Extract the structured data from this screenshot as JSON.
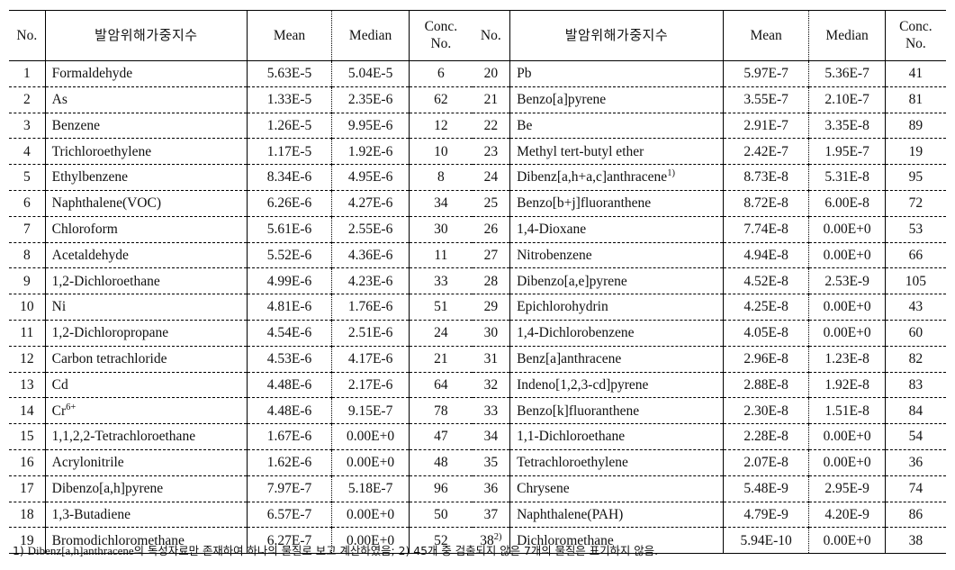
{
  "table_left": {
    "columns": [
      "No.",
      "발암위해가중지수",
      "Mean",
      "Median",
      "Conc. No."
    ],
    "headers": {
      "no": "No.",
      "name": "발암위해가중지수",
      "mean": "Mean",
      "median": "Median",
      "conc_line1": "Conc.",
      "conc_line2": "No."
    },
    "rows": [
      {
        "no": "1",
        "name": "Formaldehyde",
        "mean": "5.63E-5",
        "median": "5.04E-5",
        "conc": "6"
      },
      {
        "no": "2",
        "name": "As",
        "mean": "1.33E-5",
        "median": "2.35E-6",
        "conc": "62"
      },
      {
        "no": "3",
        "name": "Benzene",
        "mean": "1.26E-5",
        "median": "9.95E-6",
        "conc": "12"
      },
      {
        "no": "4",
        "name": "Trichloroethylene",
        "mean": "1.17E-5",
        "median": "1.92E-6",
        "conc": "10"
      },
      {
        "no": "5",
        "name": "Ethylbenzene",
        "mean": "8.34E-6",
        "median": "4.95E-6",
        "conc": "8"
      },
      {
        "no": "6",
        "name": "Naphthalene(VOC)",
        "mean": "6.26E-6",
        "median": "4.27E-6",
        "conc": "34"
      },
      {
        "no": "7",
        "name": "Chloroform",
        "mean": "5.61E-6",
        "median": "2.55E-6",
        "conc": "30"
      },
      {
        "no": "8",
        "name": "Acetaldehyde",
        "mean": "5.52E-6",
        "median": "4.36E-6",
        "conc": "11"
      },
      {
        "no": "9",
        "name": "1,2-Dichloroethane",
        "mean": "4.99E-6",
        "median": "4.23E-6",
        "conc": "33"
      },
      {
        "no": "10",
        "name": "Ni",
        "mean": "4.81E-6",
        "median": "1.76E-6",
        "conc": "51"
      },
      {
        "no": "11",
        "name": "1,2-Dichloropropane",
        "mean": "4.54E-6",
        "median": "2.51E-6",
        "conc": "24"
      },
      {
        "no": "12",
        "name": "Carbon tetrachloride",
        "mean": "4.53E-6",
        "median": "4.17E-6",
        "conc": "21"
      },
      {
        "no": "13",
        "name": "Cd",
        "mean": "4.48E-6",
        "median": "2.17E-6",
        "conc": "64"
      },
      {
        "no": "14",
        "name": "Cr",
        "name_sup": "6+",
        "mean": "4.48E-6",
        "median": "9.15E-7",
        "conc": "78"
      },
      {
        "no": "15",
        "name": "1,1,2,2-Tetrachloroethane",
        "mean": "1.67E-6",
        "median": "0.00E+0",
        "conc": "47"
      },
      {
        "no": "16",
        "name": "Acrylonitrile",
        "mean": "1.62E-6",
        "median": "0.00E+0",
        "conc": "48"
      },
      {
        "no": "17",
        "name": "Dibenzo[a,h]pyrene",
        "mean": "7.97E-7",
        "median": "5.18E-7",
        "conc": "96"
      },
      {
        "no": "18",
        "name": "1,3-Butadiene",
        "mean": "6.57E-7",
        "median": "0.00E+0",
        "conc": "50"
      },
      {
        "no": "19",
        "name": "Bromodichloromethane",
        "mean": "6.27E-7",
        "median": "0.00E+0",
        "conc": "52"
      }
    ]
  },
  "table_right": {
    "columns": [
      "No.",
      "발암위해가중지수",
      "Mean",
      "Median",
      "Conc. No."
    ],
    "headers": {
      "no": "No.",
      "name": "발암위해가중지수",
      "mean": "Mean",
      "median": "Median",
      "conc_line1": "Conc.",
      "conc_line2": "No."
    },
    "rows": [
      {
        "no": "20",
        "name": "Pb",
        "mean": "5.97E-7",
        "median": "5.36E-7",
        "conc": "41"
      },
      {
        "no": "21",
        "name": "Benzo[a]pyrene",
        "mean": "3.55E-7",
        "median": "2.10E-7",
        "conc": "81"
      },
      {
        "no": "22",
        "name": "Be",
        "mean": "2.91E-7",
        "median": "3.35E-8",
        "conc": "89"
      },
      {
        "no": "23",
        "name": "Methyl tert-butyl ether",
        "mean": "2.42E-7",
        "median": "1.95E-7",
        "conc": "19"
      },
      {
        "no": "24",
        "name": "Dibenz[a,h+a,c]anthracene",
        "name_sup": "1)",
        "mean": "8.73E-8",
        "median": "5.31E-8",
        "conc": "95"
      },
      {
        "no": "25",
        "name": "Benzo[b+j]fluoranthene",
        "mean": "8.72E-8",
        "median": "6.00E-8",
        "conc": "72"
      },
      {
        "no": "26",
        "name": "1,4-Dioxane",
        "mean": "7.74E-8",
        "median": "0.00E+0",
        "conc": "53"
      },
      {
        "no": "27",
        "name": "Nitrobenzene",
        "mean": "4.94E-8",
        "median": "0.00E+0",
        "conc": "66"
      },
      {
        "no": "28",
        "name": "Dibenzo[a,e]pyrene",
        "mean": "4.52E-8",
        "median": "2.53E-9",
        "conc": "105"
      },
      {
        "no": "29",
        "name": "Epichlorohydrin",
        "mean": "4.25E-8",
        "median": "0.00E+0",
        "conc": "43"
      },
      {
        "no": "30",
        "name": "1,4-Dichlorobenzene",
        "mean": "4.05E-8",
        "median": "0.00E+0",
        "conc": "60"
      },
      {
        "no": "31",
        "name": "Benz[a]anthracene",
        "mean": "2.96E-8",
        "median": "1.23E-8",
        "conc": "82"
      },
      {
        "no": "32",
        "name": "Indeno[1,2,3-cd]pyrene",
        "mean": "2.88E-8",
        "median": "1.92E-8",
        "conc": "83"
      },
      {
        "no": "33",
        "name": "Benzo[k]fluoranthene",
        "mean": "2.30E-8",
        "median": "1.51E-8",
        "conc": "84"
      },
      {
        "no": "34",
        "name": "1,1-Dichloroethane",
        "mean": "2.28E-8",
        "median": "0.00E+0",
        "conc": "54"
      },
      {
        "no": "35",
        "name": "Tetrachloroethylene",
        "mean": "2.07E-8",
        "median": "0.00E+0",
        "conc": "36"
      },
      {
        "no": "36",
        "name": "Chrysene",
        "mean": "5.48E-9",
        "median": "2.95E-9",
        "conc": "74"
      },
      {
        "no": "37",
        "name": "Naphthalene(PAH)",
        "mean": "4.79E-9",
        "median": "4.20E-9",
        "conc": "86"
      },
      {
        "no": "38",
        "no_sup": "2)",
        "name": "Dichloromethane",
        "mean": "5.94E-10",
        "median": "0.00E+0",
        "conc": "38"
      }
    ]
  },
  "footnote": {
    "part1_num": "1) ",
    "part1_lat": "Dibenz[a,h]anthracene",
    "part1_kor": "의 독성자료만 존재하여 하나의 물질로 보고 계산하였음; ",
    "part2_num": "2) ",
    "part2_kor": "45개 중 검출되지 않은 7개의 물질은 표기하지 않음."
  }
}
